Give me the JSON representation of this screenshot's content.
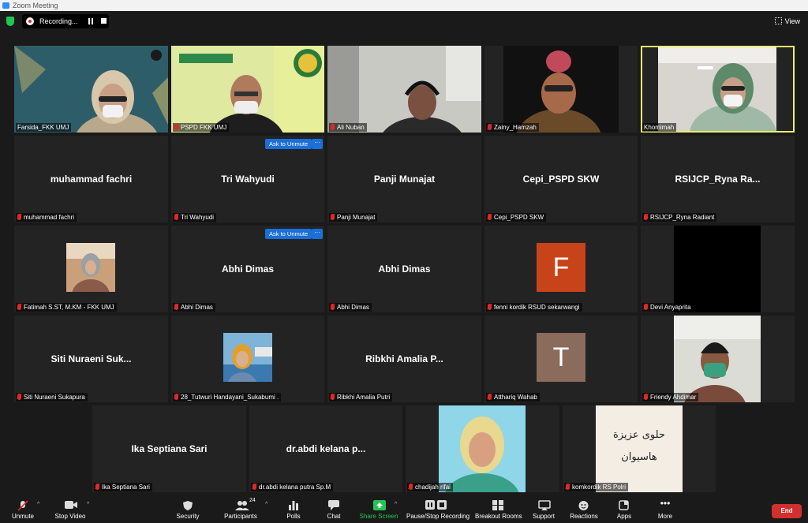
{
  "window": {
    "title": "Zoom Meeting"
  },
  "topbar": {
    "recording_label": "Recording...",
    "view_label": "View"
  },
  "tiles": {
    "farsida": {
      "label": "Farsida_FKK UMJ"
    },
    "pspd": {
      "label": "PSPD FKK UMJ"
    },
    "ali": {
      "label": "Ali Nuban"
    },
    "zainy": {
      "label": "Zainy_Hamzah"
    },
    "khomimah": {
      "label": "Khomimah"
    },
    "fachri": {
      "big": "muhammad fachri",
      "label": "muhammad fachri"
    },
    "tri": {
      "big": "Tri Wahyudi",
      "label": "Tri Wahyudi",
      "ask": "Ask to Unmute",
      "more": "···"
    },
    "panji": {
      "big": "Panji Munajat",
      "label": "Panji Munajat"
    },
    "cepi": {
      "big": "Cepi_PSPD SKW",
      "label": "Cepi_PSPD SKW"
    },
    "rsijcp": {
      "big": "RSIJCP_Ryna  Ra...",
      "label": "RSIJCP_Ryna Radiant"
    },
    "fatimah": {
      "label": "Fatimah S.ST, M.KM - FKK UMJ"
    },
    "abhi1": {
      "big": "Abhi Dimas",
      "label": "Abhi Dimas",
      "ask": "Ask to Unmute",
      "more": "···"
    },
    "abhi2": {
      "big": "Abhi Dimas",
      "label": "Abhi Dimas"
    },
    "fenni": {
      "letter": "F",
      "label": "fenni kordik RSUD sekarwangi",
      "color": "#c9431a"
    },
    "devi": {
      "label": "Devi Anyaprita"
    },
    "siti": {
      "big": "Siti  Nuraeni  Suk...",
      "label": "Siti Nuraeni Sukapura"
    },
    "tutwuri": {
      "label": "28_Tutwuri Handayani_Sukabumi ."
    },
    "ribkhi": {
      "big": "Ribkhi Amalia  P...",
      "label": "Ribkhi Amalia Putri"
    },
    "atthariq": {
      "letter": "T",
      "label": "Atthariq Wahab",
      "color": "#8a6b5c"
    },
    "friendy": {
      "label": "Friendy Ahdimar"
    },
    "ika": {
      "big": "Ika Septiana Sari",
      "label": "Ika Septiana Sari"
    },
    "abdi": {
      "big": "dr.abdi kelana p...",
      "label": "dr.abdi kelana putra Sp.M"
    },
    "chadijah": {
      "label": "chadijah rifai"
    },
    "komkordik": {
      "label": "komkordik RS Polri",
      "arabic_line1": "حلوى عزيزة",
      "arabic_line2": "هاسيوان"
    }
  },
  "toolbar": {
    "unmute": "Unmute",
    "stop_video": "Stop Video",
    "security": "Security",
    "participants": "Participants",
    "participant_count": "24",
    "polls": "Polls",
    "chat": "Chat",
    "share_screen": "Share Screen",
    "pause_stop_recording": "Pause/Stop Recording",
    "breakout_rooms": "Breakout Rooms",
    "support": "Support",
    "reactions": "Reactions",
    "apps": "Apps",
    "more": "More",
    "end": "End"
  },
  "colors": {
    "accent": "#2d8cff",
    "end": "#d32f2f",
    "share": "#23c552",
    "active_speaker": "#e8f06a"
  }
}
